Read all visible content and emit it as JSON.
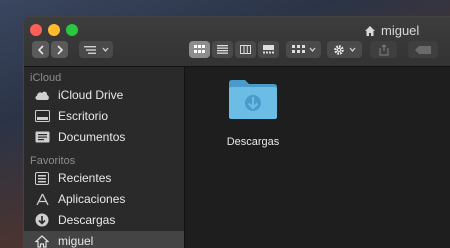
{
  "window": {
    "title": "miguel"
  },
  "toolbar": {
    "back_icon": "chevron-left-icon",
    "forward_icon": "chevron-right-icon",
    "path_icon": "path-list-icon",
    "view_modes": [
      "icons",
      "list",
      "columns",
      "gallery"
    ],
    "selected_view": "icons",
    "group_icon": "group-grid-icon",
    "action_icon": "gear-icon",
    "share_icon": "share-icon",
    "tag_icon": "tag-icon"
  },
  "sidebar": {
    "sections": [
      {
        "title": "iCloud",
        "items": [
          {
            "label": "iCloud Drive",
            "icon": "cloud-icon"
          },
          {
            "label": "Escritorio",
            "icon": "desktop-icon"
          },
          {
            "label": "Documentos",
            "icon": "document-icon"
          }
        ]
      },
      {
        "title": "Favoritos",
        "items": [
          {
            "label": "Recientes",
            "icon": "recents-icon"
          },
          {
            "label": "Aplicaciones",
            "icon": "applications-icon"
          },
          {
            "label": "Descargas",
            "icon": "downloads-icon"
          },
          {
            "label": "miguel",
            "icon": "home-icon",
            "selected": true
          }
        ]
      }
    ]
  },
  "content": {
    "items": [
      {
        "label": "Descargas",
        "icon": "downloads-folder-icon"
      }
    ]
  },
  "colors": {
    "accent": "#5fb2dd",
    "window_bg": "#1e1e1e",
    "sidebar_bg": "#2a2a2a"
  }
}
